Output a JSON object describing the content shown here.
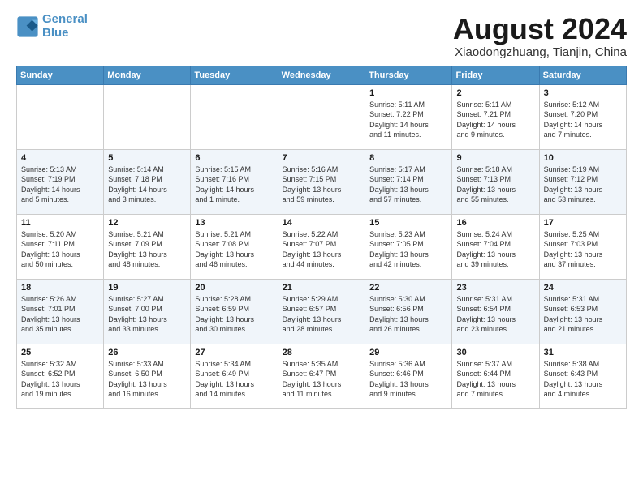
{
  "logo": {
    "line1": "General",
    "line2": "Blue"
  },
  "title": "August 2024",
  "subtitle": "Xiaodongzhuang, Tianjin, China",
  "days_of_week": [
    "Sunday",
    "Monday",
    "Tuesday",
    "Wednesday",
    "Thursday",
    "Friday",
    "Saturday"
  ],
  "weeks": [
    [
      {
        "day": "",
        "info": ""
      },
      {
        "day": "",
        "info": ""
      },
      {
        "day": "",
        "info": ""
      },
      {
        "day": "",
        "info": ""
      },
      {
        "day": "1",
        "info": "Sunrise: 5:11 AM\nSunset: 7:22 PM\nDaylight: 14 hours\nand 11 minutes."
      },
      {
        "day": "2",
        "info": "Sunrise: 5:11 AM\nSunset: 7:21 PM\nDaylight: 14 hours\nand 9 minutes."
      },
      {
        "day": "3",
        "info": "Sunrise: 5:12 AM\nSunset: 7:20 PM\nDaylight: 14 hours\nand 7 minutes."
      }
    ],
    [
      {
        "day": "4",
        "info": "Sunrise: 5:13 AM\nSunset: 7:19 PM\nDaylight: 14 hours\nand 5 minutes."
      },
      {
        "day": "5",
        "info": "Sunrise: 5:14 AM\nSunset: 7:18 PM\nDaylight: 14 hours\nand 3 minutes."
      },
      {
        "day": "6",
        "info": "Sunrise: 5:15 AM\nSunset: 7:16 PM\nDaylight: 14 hours\nand 1 minute."
      },
      {
        "day": "7",
        "info": "Sunrise: 5:16 AM\nSunset: 7:15 PM\nDaylight: 13 hours\nand 59 minutes."
      },
      {
        "day": "8",
        "info": "Sunrise: 5:17 AM\nSunset: 7:14 PM\nDaylight: 13 hours\nand 57 minutes."
      },
      {
        "day": "9",
        "info": "Sunrise: 5:18 AM\nSunset: 7:13 PM\nDaylight: 13 hours\nand 55 minutes."
      },
      {
        "day": "10",
        "info": "Sunrise: 5:19 AM\nSunset: 7:12 PM\nDaylight: 13 hours\nand 53 minutes."
      }
    ],
    [
      {
        "day": "11",
        "info": "Sunrise: 5:20 AM\nSunset: 7:11 PM\nDaylight: 13 hours\nand 50 minutes."
      },
      {
        "day": "12",
        "info": "Sunrise: 5:21 AM\nSunset: 7:09 PM\nDaylight: 13 hours\nand 48 minutes."
      },
      {
        "day": "13",
        "info": "Sunrise: 5:21 AM\nSunset: 7:08 PM\nDaylight: 13 hours\nand 46 minutes."
      },
      {
        "day": "14",
        "info": "Sunrise: 5:22 AM\nSunset: 7:07 PM\nDaylight: 13 hours\nand 44 minutes."
      },
      {
        "day": "15",
        "info": "Sunrise: 5:23 AM\nSunset: 7:05 PM\nDaylight: 13 hours\nand 42 minutes."
      },
      {
        "day": "16",
        "info": "Sunrise: 5:24 AM\nSunset: 7:04 PM\nDaylight: 13 hours\nand 39 minutes."
      },
      {
        "day": "17",
        "info": "Sunrise: 5:25 AM\nSunset: 7:03 PM\nDaylight: 13 hours\nand 37 minutes."
      }
    ],
    [
      {
        "day": "18",
        "info": "Sunrise: 5:26 AM\nSunset: 7:01 PM\nDaylight: 13 hours\nand 35 minutes."
      },
      {
        "day": "19",
        "info": "Sunrise: 5:27 AM\nSunset: 7:00 PM\nDaylight: 13 hours\nand 33 minutes."
      },
      {
        "day": "20",
        "info": "Sunrise: 5:28 AM\nSunset: 6:59 PM\nDaylight: 13 hours\nand 30 minutes."
      },
      {
        "day": "21",
        "info": "Sunrise: 5:29 AM\nSunset: 6:57 PM\nDaylight: 13 hours\nand 28 minutes."
      },
      {
        "day": "22",
        "info": "Sunrise: 5:30 AM\nSunset: 6:56 PM\nDaylight: 13 hours\nand 26 minutes."
      },
      {
        "day": "23",
        "info": "Sunrise: 5:31 AM\nSunset: 6:54 PM\nDaylight: 13 hours\nand 23 minutes."
      },
      {
        "day": "24",
        "info": "Sunrise: 5:31 AM\nSunset: 6:53 PM\nDaylight: 13 hours\nand 21 minutes."
      }
    ],
    [
      {
        "day": "25",
        "info": "Sunrise: 5:32 AM\nSunset: 6:52 PM\nDaylight: 13 hours\nand 19 minutes."
      },
      {
        "day": "26",
        "info": "Sunrise: 5:33 AM\nSunset: 6:50 PM\nDaylight: 13 hours\nand 16 minutes."
      },
      {
        "day": "27",
        "info": "Sunrise: 5:34 AM\nSunset: 6:49 PM\nDaylight: 13 hours\nand 14 minutes."
      },
      {
        "day": "28",
        "info": "Sunrise: 5:35 AM\nSunset: 6:47 PM\nDaylight: 13 hours\nand 11 minutes."
      },
      {
        "day": "29",
        "info": "Sunrise: 5:36 AM\nSunset: 6:46 PM\nDaylight: 13 hours\nand 9 minutes."
      },
      {
        "day": "30",
        "info": "Sunrise: 5:37 AM\nSunset: 6:44 PM\nDaylight: 13 hours\nand 7 minutes."
      },
      {
        "day": "31",
        "info": "Sunrise: 5:38 AM\nSunset: 6:43 PM\nDaylight: 13 hours\nand 4 minutes."
      }
    ]
  ]
}
